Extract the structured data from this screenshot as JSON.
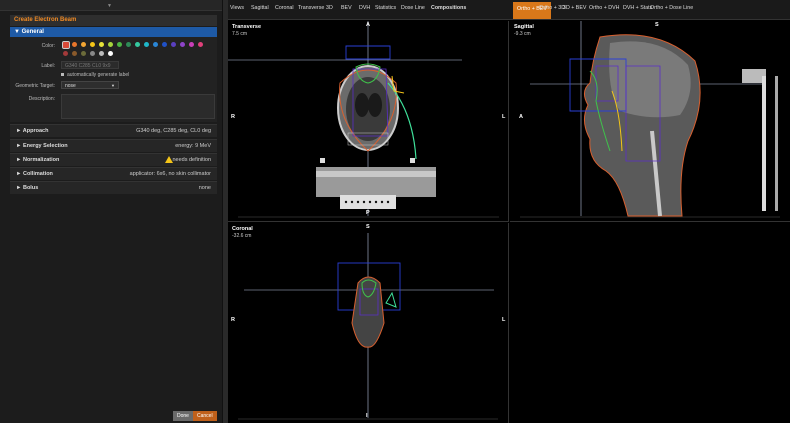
{
  "panel": {
    "title": "Create Electron Beam",
    "general_label": "▼ General",
    "color_label": "Color:",
    "label_label": "Label:",
    "label_value": "G340 C285 CL0 9x9",
    "auto_label_text": "automatically generate label",
    "geometric_target_label": "Geometric Target:",
    "geometric_target_value": "nose",
    "description_label": "Description:",
    "swatch_colors": [
      "#d94a38",
      "#e8762b",
      "#f2a533",
      "#f5c518",
      "#e6e23a",
      "#a7d43c",
      "#4bb543",
      "#2e8b57",
      "#35c9a0",
      "#1fb7c9",
      "#2a86d6",
      "#2051c7",
      "#5a3fc0",
      "#8e44c9",
      "#c93fb8",
      "#e0407a",
      "#a33a3a",
      "#8a5a2b",
      "#6b6b3a",
      "#888888",
      "#bbbbbb",
      "#ffffff"
    ],
    "sections": [
      {
        "title": "► Approach",
        "summary": "G340 deg, C285 deg, CL0 deg"
      },
      {
        "title": "► Energy Selection",
        "summary": "energy: 9 MeV"
      },
      {
        "title": "► Normalization",
        "summary": "needs definition"
      },
      {
        "title": "► Collimation",
        "summary": "applicator: 6x6, no skin collimator"
      },
      {
        "title": "► Bolus",
        "summary": "none"
      }
    ],
    "done_label": "Done",
    "cancel_label": "Cancel"
  },
  "tabs": [
    "Views",
    "Sagittal",
    "Coronal",
    "Transverse",
    "3D",
    "BEV",
    "DVH",
    "Statistics",
    "Dose Line",
    "Compositions",
    "Ortho + BEV",
    "Ortho + 3D",
    "3D + BEV",
    "Ortho + DVH",
    "DVH + Stats",
    "Ortho + Dose Line"
  ],
  "active_tab": "Ortho + BEV",
  "views": {
    "transverse": {
      "title": "Transverse",
      "sub": "7.5 cm",
      "top": "A",
      "bottom": "P",
      "left": "R",
      "right": "L"
    },
    "sagittal": {
      "title": "Sagittal",
      "sub": "-9.3 cm",
      "top": "S",
      "left": "A"
    },
    "coronal": {
      "title": "Coronal",
      "sub": "-32.6 cm",
      "top": "S",
      "bottom": "I",
      "left": "R",
      "right": "L"
    }
  },
  "colors": {
    "accent": "#d9781a",
    "header_blue": "#1e5aa6",
    "warning": "#f5c518"
  }
}
